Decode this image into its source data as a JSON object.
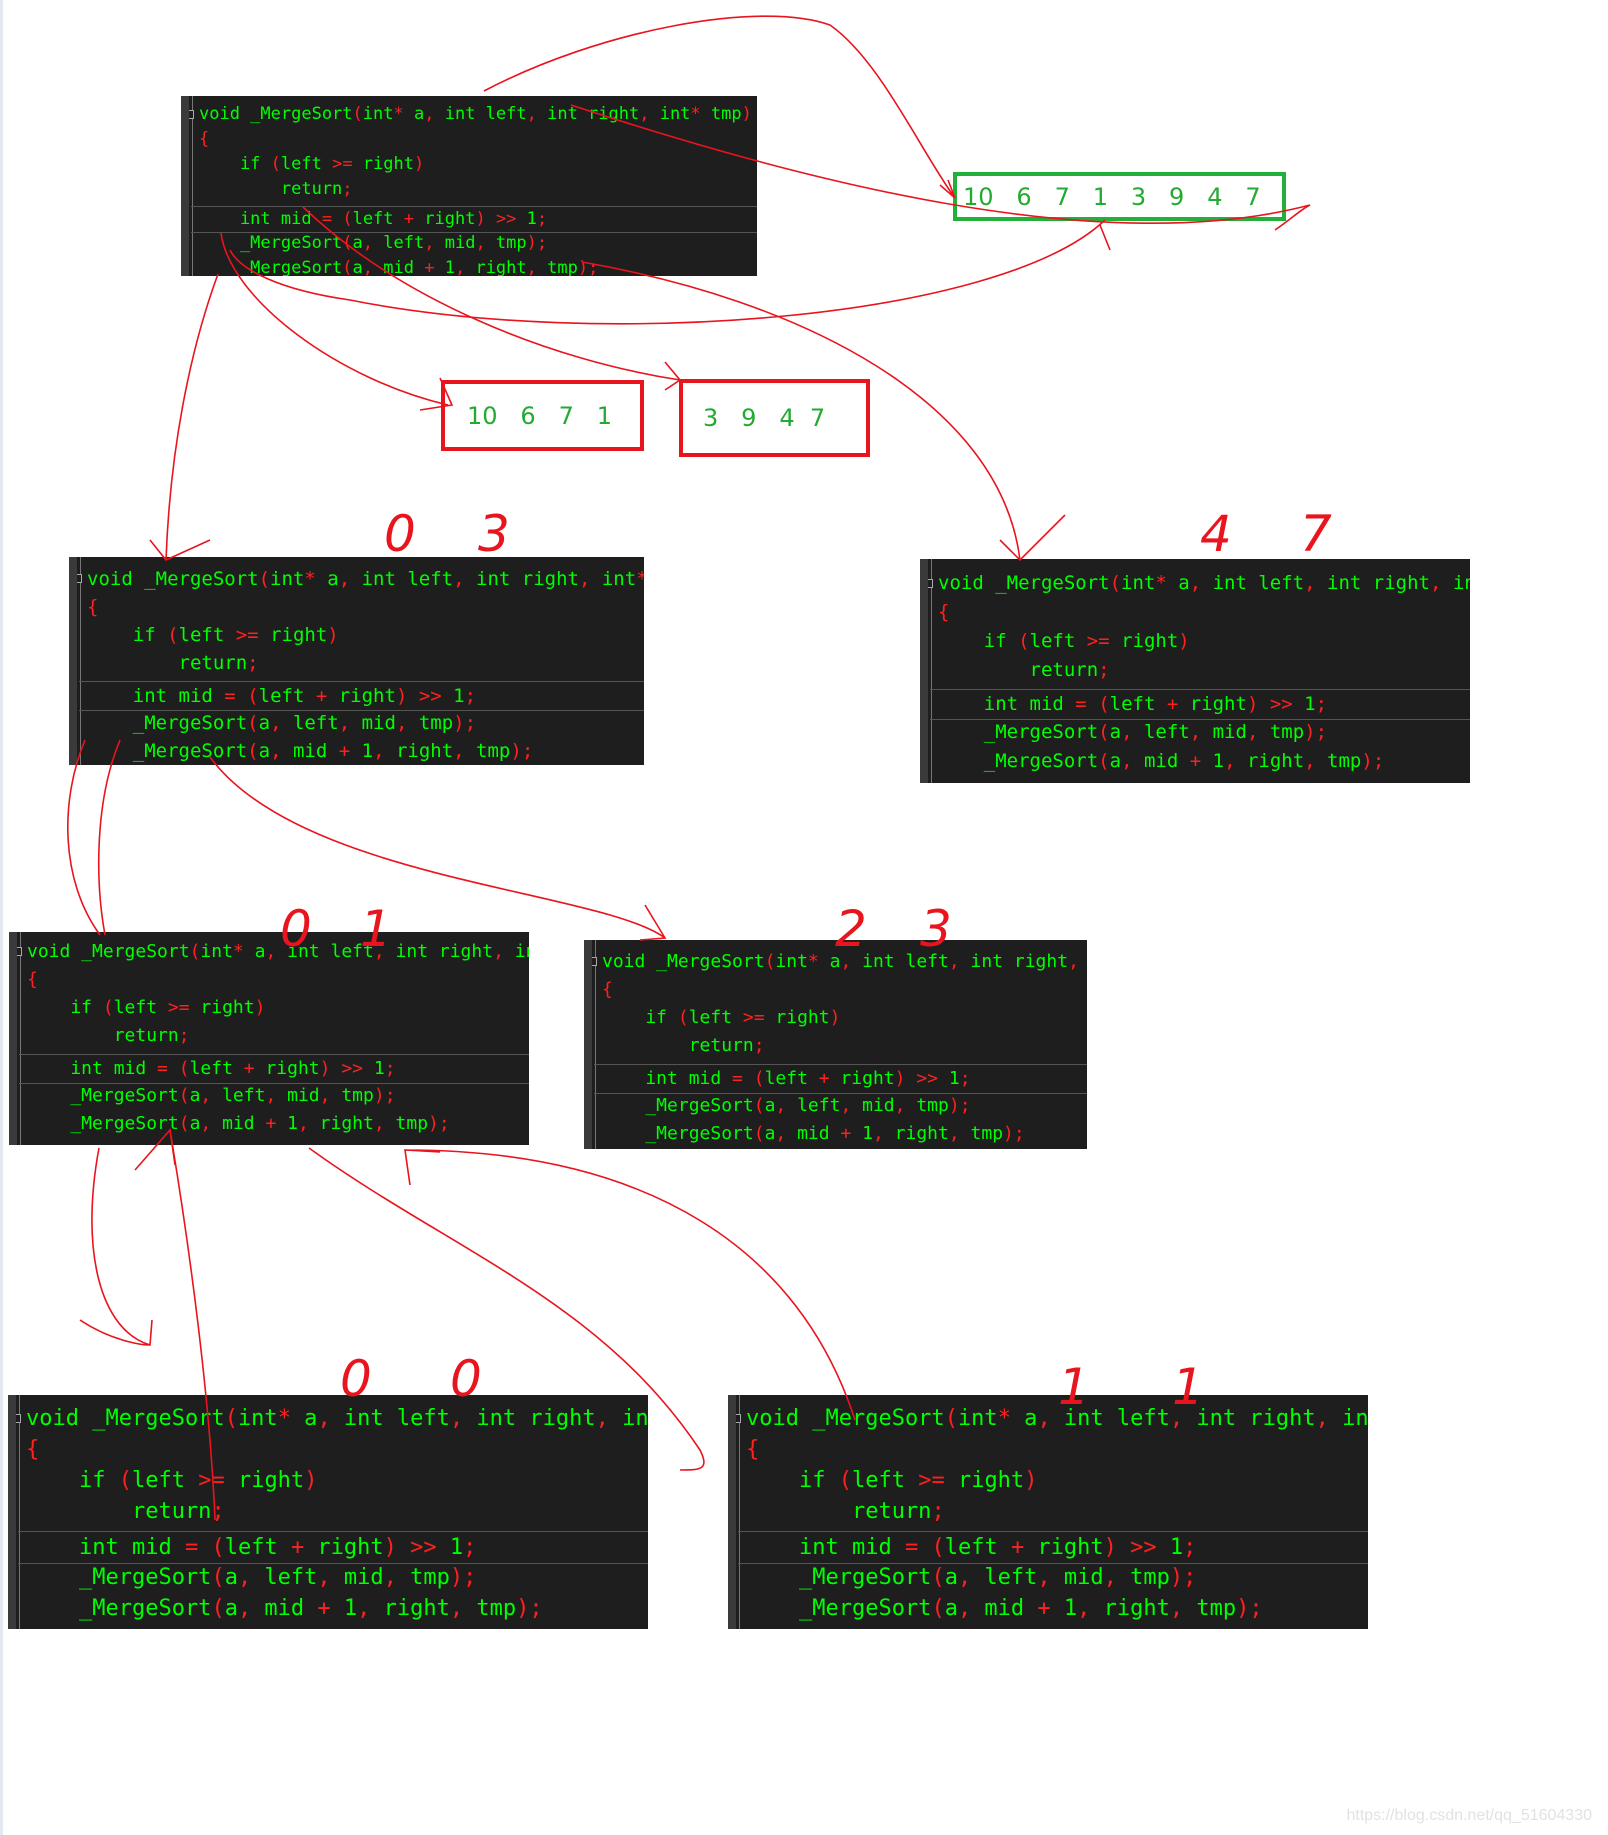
{
  "code": {
    "lines": [
      "void _MergeSort(int* a, int left, int right, int* tmp)",
      "{",
      "    if (left >= right)",
      "        return;",
      "    int mid = (left + right) >> 1;",
      "    _MergeSort(a, left, mid, tmp);",
      "    _MergeSort(a, mid + 1, right, tmp);"
    ]
  },
  "blocks": [
    {
      "id": "b1",
      "annotations": [
        "",
        ""
      ]
    },
    {
      "id": "b2",
      "annotations": [
        "0",
        "3"
      ]
    },
    {
      "id": "b3",
      "annotations": [
        "4",
        "7"
      ]
    },
    {
      "id": "b4",
      "annotations": [
        "0",
        "1"
      ]
    },
    {
      "id": "b5",
      "annotations": [
        "2",
        "3"
      ]
    },
    {
      "id": "b6",
      "annotations": [
        "0",
        "0"
      ]
    },
    {
      "id": "b7",
      "annotations": [
        "1",
        "1"
      ]
    }
  ],
  "arrays": {
    "full": "10   6   7   1   3   9   4   7",
    "left_half": "10   6   7   1",
    "right_half": "3   9   4  7"
  },
  "colors": {
    "code_bg": "#1e1e1e",
    "code_text": "#00ff00",
    "punct": "#ff2020",
    "ink": "#e8141e",
    "array_box": "#22b03a"
  },
  "watermark": "https://blog.csdn.net/qq_51604330"
}
